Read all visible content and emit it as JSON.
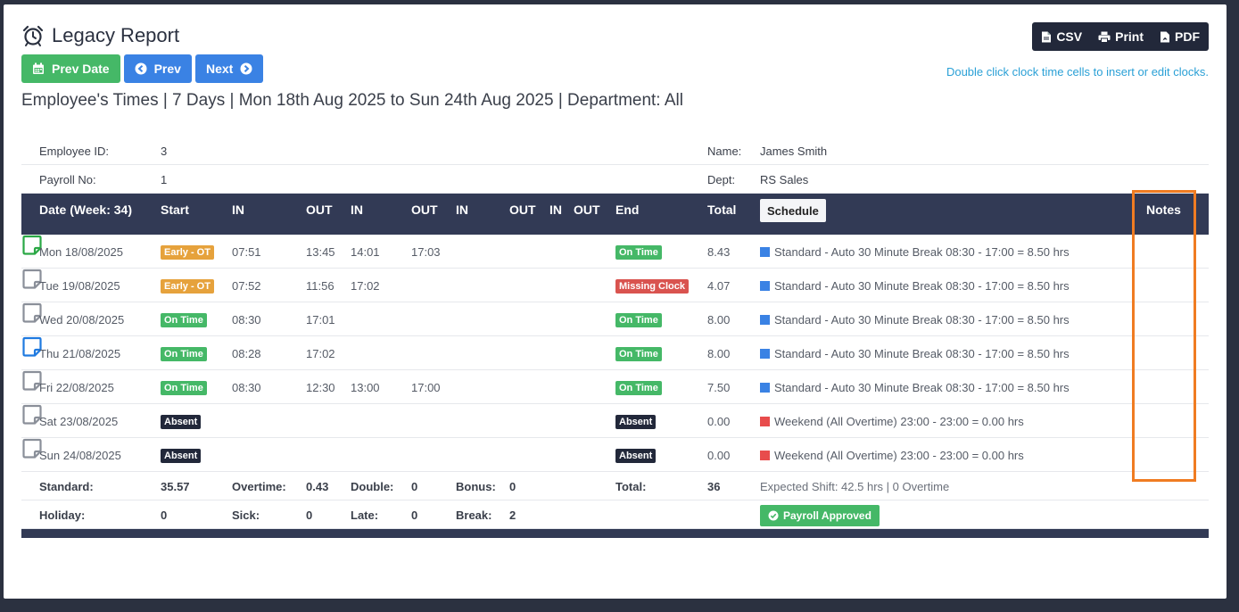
{
  "title": "Legacy Report",
  "nav": {
    "prev_date": "Prev Date",
    "prev": "Prev",
    "next": "Next"
  },
  "export": {
    "csv": "CSV",
    "print": "Print",
    "pdf": "PDF"
  },
  "hint": "Double click clock time cells to insert or edit clocks.",
  "subtitle": "Employee's Times | 7 Days | Mon 18th Aug 2025 to Sun 24th Aug 2025 | Department: All",
  "employee": {
    "id_label": "Employee ID:",
    "id": "3",
    "payroll_label": "Payroll No:",
    "payroll": "1",
    "name_label": "Name:",
    "name": "James Smith",
    "dept_label": "Dept:",
    "dept": "RS Sales"
  },
  "headers": {
    "date": "Date (Week: 34)",
    "start": "Start",
    "in1": "IN",
    "out1": "OUT",
    "in2": "IN",
    "out2": "OUT",
    "in3": "IN",
    "out3": "OUT",
    "in4": "IN",
    "out4": "OUT",
    "end": "End",
    "total": "Total",
    "schedule": "Schedule",
    "notes": "Notes"
  },
  "rows": [
    {
      "date": "Mon 18/08/2025",
      "start": "Early - OT",
      "start_color": "#e6a23c",
      "in1": "07:51",
      "out1": "13:45",
      "in2": "14:01",
      "out2": "17:03",
      "end": "On Time",
      "end_color": "#45b867",
      "total": "8.43",
      "schedule": "Standard - Auto 30 Minute Break 08:30 - 17:00 = 8.50 hrs",
      "sched_color": "#3a82e4",
      "note_color": "#2aa845"
    },
    {
      "date": "Tue 19/08/2025",
      "start": "Early - OT",
      "start_color": "#e6a23c",
      "in1": "07:52",
      "out1": "11:56",
      "in2": "17:02",
      "out2": "",
      "end": "Missing Clock",
      "end_color": "#d9534f",
      "total": "4.07",
      "schedule": "Standard - Auto 30 Minute Break 08:30 - 17:00 = 8.50 hrs",
      "sched_color": "#3a82e4",
      "note_color": "#8a8f99"
    },
    {
      "date": "Wed 20/08/2025",
      "start": "On Time",
      "start_color": "#45b867",
      "in1": "08:30",
      "out1": "17:01",
      "in2": "",
      "out2": "",
      "end": "On Time",
      "end_color": "#45b867",
      "total": "8.00",
      "schedule": "Standard - Auto 30 Minute Break 08:30 - 17:00 = 8.50 hrs",
      "sched_color": "#3a82e4",
      "note_color": "#8a8f99"
    },
    {
      "date": "Thu 21/08/2025",
      "start": "On Time",
      "start_color": "#45b867",
      "in1": "08:28",
      "out1": "17:02",
      "in2": "",
      "out2": "",
      "end": "On Time",
      "end_color": "#45b867",
      "total": "8.00",
      "schedule": "Standard - Auto 30 Minute Break 08:30 - 17:00 = 8.50 hrs",
      "sched_color": "#3a82e4",
      "note_color": "#1f7ae0"
    },
    {
      "date": "Fri 22/08/2025",
      "start": "On Time",
      "start_color": "#45b867",
      "in1": "08:30",
      "out1": "12:30",
      "in2": "13:00",
      "out2": "17:00",
      "end": "On Time",
      "end_color": "#45b867",
      "total": "7.50",
      "schedule": "Standard - Auto 30 Minute Break 08:30 - 17:00 = 8.50 hrs",
      "sched_color": "#3a82e4",
      "note_color": "#8a8f99"
    },
    {
      "date": "Sat 23/08/2025",
      "start": "Absent",
      "start_color": "#22283a",
      "in1": "",
      "out1": "",
      "in2": "",
      "out2": "",
      "end": "Absent",
      "end_color": "#22283a",
      "total": "0.00",
      "schedule": "Weekend (All Overtime) 23:00 - 23:00 = 0.00 hrs",
      "sched_color": "#e84c4c",
      "note_color": "#8a8f99"
    },
    {
      "date": "Sun 24/08/2025",
      "start": "Absent",
      "start_color": "#22283a",
      "in1": "",
      "out1": "",
      "in2": "",
      "out2": "",
      "end": "Absent",
      "end_color": "#22283a",
      "total": "0.00",
      "schedule": "Weekend (All Overtime) 23:00 - 23:00 = 0.00 hrs",
      "sched_color": "#e84c4c",
      "note_color": "#8a8f99"
    }
  ],
  "summary": {
    "standard_label": "Standard:",
    "standard": "35.57",
    "overtime_label": "Overtime:",
    "overtime": "0.43",
    "double_label": "Double:",
    "double": "0",
    "bonus_label": "Bonus:",
    "bonus": "0",
    "total_label": "Total:",
    "total": "36",
    "expected": "Expected Shift: 42.5 hrs | 0 Overtime",
    "holiday_label": "Holiday:",
    "holiday": "0",
    "sick_label": "Sick:",
    "sick": "0",
    "late_label": "Late:",
    "late": "0",
    "break_label": "Break:",
    "break": "2",
    "approved": "Payroll Approved"
  }
}
